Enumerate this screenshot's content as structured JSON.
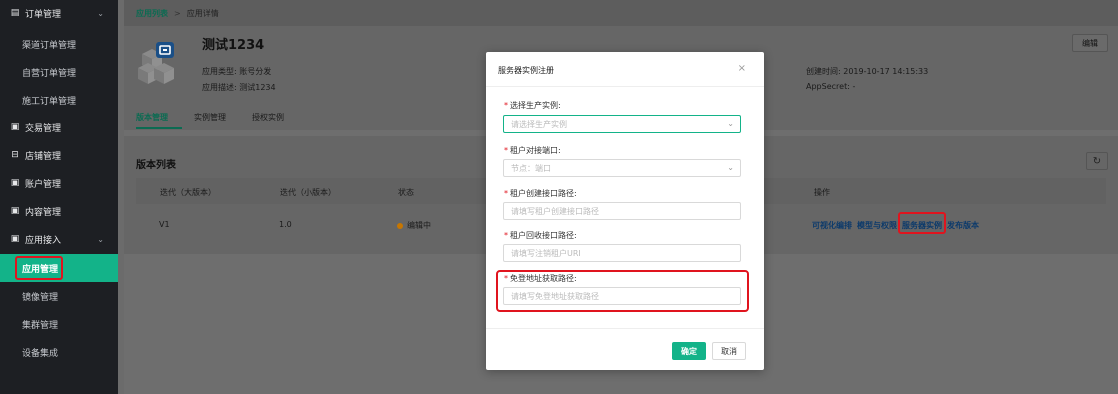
{
  "sidebar": {
    "groups": [
      {
        "label": "订单管理",
        "icon": "order-icon"
      },
      {
        "label": "交易管理",
        "icon": "transaction-icon"
      },
      {
        "label": "店铺管理",
        "icon": "store-icon"
      },
      {
        "label": "账户管理",
        "icon": "account-icon"
      },
      {
        "label": "内容管理",
        "icon": "content-icon"
      },
      {
        "label": "应用接入",
        "icon": "app-access-icon"
      }
    ],
    "order_items": [
      "渠道订单管理",
      "自营订单管理",
      "施工订单管理"
    ],
    "app_items": [
      "应用管理",
      "镜像管理",
      "集群管理",
      "设备集成"
    ],
    "active_item": "应用管理"
  },
  "breadcrumb": {
    "parent": "应用列表",
    "separator": ">",
    "current": "应用详情"
  },
  "app": {
    "title": "测试1234",
    "type_label": "应用类型:",
    "type_value": "账号分发",
    "desc_label": "应用描述:",
    "desc_value": "测试1234",
    "created_label": "创建时间:",
    "created_value": "2019-10-17 14:15:33",
    "secret_label": "AppSecret:",
    "secret_value": "-",
    "edit_label": "编辑"
  },
  "tabs": [
    "版本管理",
    "实例管理",
    "授权实例"
  ],
  "version_list": {
    "title": "版本列表",
    "columns": [
      "迭代（大版本）",
      "迭代（小版本）",
      "状态",
      "操作"
    ],
    "rows": [
      {
        "major": "V1",
        "minor": "1.0",
        "status": "编辑中"
      }
    ],
    "actions": [
      "可视化编排",
      "模型与权限",
      "服务器实例",
      "发布版本"
    ]
  },
  "modal": {
    "title": "服务器实例注册",
    "close": "×",
    "fields": [
      {
        "label": "选择生产实例:",
        "placeholder": "请选择生产实例",
        "type": "select"
      },
      {
        "label": "租户对接端口:",
        "placeholder": "节点：端口",
        "type": "select"
      },
      {
        "label": "租户创建接口路径:",
        "placeholder": "请填写租户创建接口路径",
        "type": "input"
      },
      {
        "label": "租户回收接口路径:",
        "placeholder": "请填写注销租户URI",
        "type": "input"
      },
      {
        "label": "免登地址获取路径:",
        "placeholder": "请填写免登地址获取路径",
        "type": "input"
      }
    ],
    "required_mark": "*",
    "ok_label": "确定",
    "cancel_label": "取消"
  },
  "colors": {
    "accent": "#13b389",
    "highlight": "#e0141e",
    "link": "#0c3a6b"
  }
}
